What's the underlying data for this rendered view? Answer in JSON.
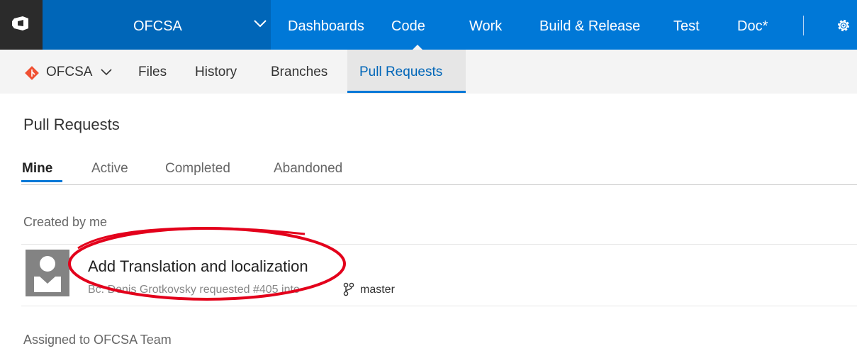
{
  "topnav": {
    "project": "OFCSA",
    "items": [
      "Dashboards",
      "Code",
      "Work",
      "Build & Release",
      "Test",
      "Doc*"
    ],
    "selected": "Code"
  },
  "subnav": {
    "repo": "OFCSA",
    "items": [
      "Files",
      "History",
      "Branches",
      "Pull Requests"
    ],
    "selected": "Pull Requests"
  },
  "page": {
    "title": "Pull Requests",
    "tabs": [
      "Mine",
      "Active",
      "Completed",
      "Abandoned"
    ],
    "active_tab": "Mine"
  },
  "sections": {
    "created_by_me": {
      "heading": "Created by me",
      "items": [
        {
          "title": "Add Translation and localization",
          "meta": "Bc. Denis Grotkovsky requested #405 into",
          "target_branch": "master"
        }
      ]
    },
    "assigned_to_team": {
      "heading": "Assigned to OFCSA Team"
    }
  },
  "colors": {
    "accent": "#0078d7",
    "annotation": "#e3001b"
  },
  "icons": {
    "logo": "vsts-logo-icon",
    "settings": "gear-icon",
    "repo": "git-repo-icon",
    "branch": "branch-icon"
  }
}
